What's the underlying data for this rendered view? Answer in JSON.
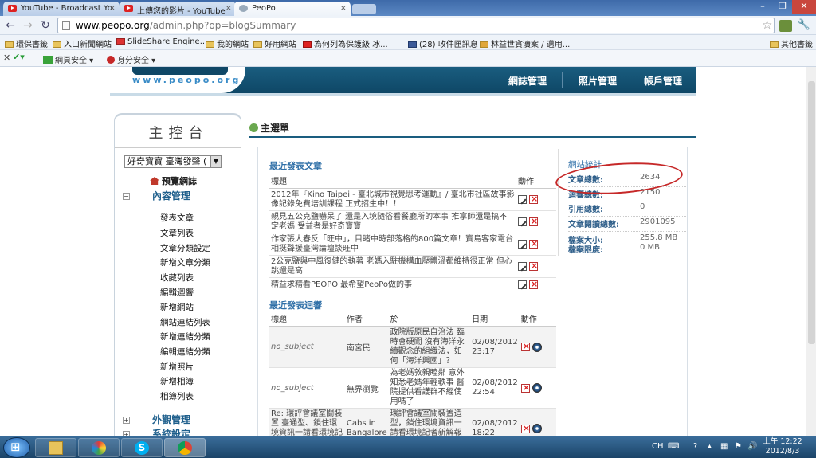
{
  "browser": {
    "tabs": [
      {
        "label": "YouTube - Broadcast Yo",
        "icon": "youtube-icon"
      },
      {
        "label": "上傳您的影片 - YouTube",
        "icon": "youtube-icon"
      },
      {
        "label": "PeoPo",
        "icon": "globe-icon"
      }
    ],
    "url_host": "www.peopo.org",
    "url_path": "/admin.php?op=blogSummary",
    "bookmarks": [
      "環保書籤",
      "入口新聞網站",
      "SlideShare Engine...",
      "我的網站",
      "好用網站",
      "為何列為保護級 冰...",
      "(28) 收件匣訊息",
      "林益世貪瀆案 / 邁用...",
      "其他書籤"
    ],
    "ext_items": [
      "網頁安全",
      "身分安全"
    ]
  },
  "site": {
    "logo": "www.peopo.org",
    "nav": [
      "網誌管理",
      "照片管理",
      "帳戶管理"
    ]
  },
  "sidebar": {
    "title": "主控台",
    "site_select": "好奇寶寶 臺灣發聲 (",
    "preview": "預覽網誌",
    "content_section": "內容管理",
    "items": [
      "發表文章",
      "文章列表",
      "文章分類設定",
      "新增文章分類",
      "收藏列表",
      "編輯迴響",
      "新增網站",
      "網站連結列表",
      "新增連結分類",
      "編輯連結分類",
      "新增照片",
      "新增相簿",
      "相簿列表"
    ],
    "appearance_section": "外觀管理",
    "system_section": "系統設定"
  },
  "main": {
    "title": "主選單",
    "recent_posts": {
      "title": "最近發表文章",
      "col_title": "標題",
      "col_action": "動作",
      "rows": [
        "2012年『Kino Taipei - 臺北城市視覺思考運動』/ 臺北市社區故事影像記錄免費培訓課程 正式招生中！！",
        "親見五公克鹽嚇呆了 還是入境隨俗看餐廳所的本事 推拿師還是搞不定老媽 受益者是好奇寶寶",
        "作家張大春反「旺中」，目睹中時部落格的800篇文章！寶島客家電台相挺聲援臺灣論壇談旺中",
        "2公克鹽與中風復健的執著 老媽入駐機構血壓體溫都維持很正常 但心跳還是高",
        "精益求精看PEOPO 最希望PeoPo做的事"
      ]
    },
    "recent_comments": {
      "title": "最近發表迴響",
      "col_title": "標題",
      "col_author": "作者",
      "col_on": "於",
      "col_date": "日期",
      "col_action": "動作",
      "rows": [
        {
          "title": "no_subject",
          "author": "南宮民",
          "on": "政院版原民自治法 臨時會硬闖 沒有海洋永續觀念的組織法，如何「海洋興國」？",
          "date": "02/08/2012 23:17"
        },
        {
          "title": "no_subject",
          "author": "無界瀏覽",
          "on": "為老媽敦親睦鄰 意外知悉老媽年輕軼事 醫院提供看護群不經使用嗎了",
          "date": "02/08/2012 22:54"
        },
        {
          "title": "Re: 環評會議室關裝置 臺通型、鎖住環境資訊一請看環境記者新解報導",
          "author": "Cabs in Bangalore",
          "on": "環評會議室關裝置造型，鎖住環境資訊一請看環境記者新解報導",
          "date": "02/08/2012 18:22"
        }
      ]
    }
  },
  "stats": {
    "title": "網站統計",
    "rows": [
      {
        "label": "文章總數:",
        "value": "2634"
      },
      {
        "label": "迴響總數:",
        "value": "2150"
      },
      {
        "label": "引用總數:",
        "value": "0"
      },
      {
        "label": "文章閱讀總數:",
        "value": "2901095"
      },
      {
        "label": "檔案大小:",
        "value": "255.8 MB"
      },
      {
        "label": "檔案限度:",
        "value": "0 MB"
      }
    ]
  },
  "taskbar": {
    "lang": "CH",
    "time": "上午 12:22",
    "date": "2012/8/3"
  },
  "colors": {
    "banner": "#1a5d7f",
    "link": "#2f6fa7",
    "highlight_circle": "#c62828"
  }
}
